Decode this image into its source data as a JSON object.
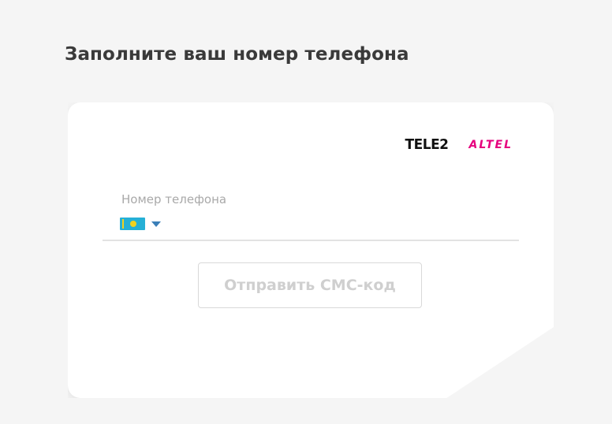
{
  "page": {
    "title": "Заполните ваш номер телефона"
  },
  "brands": {
    "tele2": "TELE2",
    "altel": "ALTEL"
  },
  "phone_form": {
    "label": "Номер телефона",
    "country_flag": "kazakhstan-flag-icon",
    "phone_value": "",
    "submit_label": "Отправить СМС-код"
  },
  "colors": {
    "background": "#f5f5f5",
    "card": "#ffffff",
    "altel_brand": "#e6007e",
    "chevron": "#3b7fb8",
    "disabled_text": "#cfcfcf"
  }
}
